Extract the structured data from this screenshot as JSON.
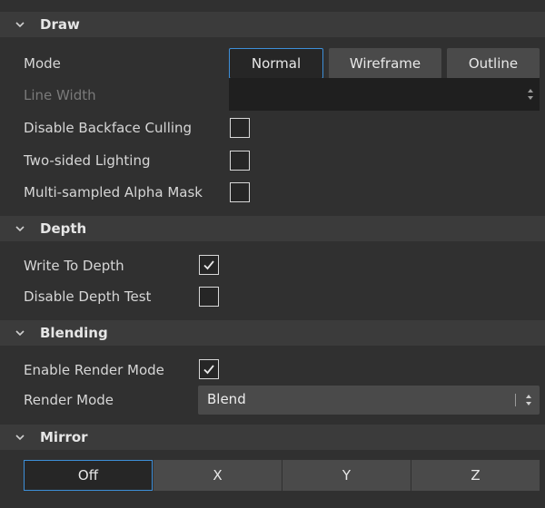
{
  "sections": {
    "draw": {
      "title": "Draw",
      "mode_label": "Mode",
      "mode_options": [
        "Normal",
        "Wireframe",
        "Outline"
      ],
      "mode_selected": "Normal",
      "line_width_label": "Line Width",
      "line_width_value": "",
      "disable_backface_label": "Disable Backface Culling",
      "disable_backface_checked": false,
      "two_sided_label": "Two-sided Lighting",
      "two_sided_checked": false,
      "alpha_mask_label": "Multi-sampled Alpha Mask",
      "alpha_mask_checked": false
    },
    "depth": {
      "title": "Depth",
      "write_label": "Write To Depth",
      "write_checked": true,
      "disable_test_label": "Disable Depth Test",
      "disable_test_checked": false
    },
    "blending": {
      "title": "Blending",
      "enable_label": "Enable Render Mode",
      "enable_checked": true,
      "render_mode_label": "Render Mode",
      "render_mode_value": "Blend"
    },
    "mirror": {
      "title": "Mirror",
      "options": [
        "Off",
        "X",
        "Y",
        "Z"
      ],
      "selected": "Off"
    }
  },
  "colors": {
    "background": "#303030",
    "header": "#3b3b3b",
    "accent": "#3d8fd9",
    "button": "#4a4a4a",
    "field": "#1f1f1f"
  },
  "icons": [
    "chevron-down-icon",
    "checkmark-icon",
    "spinner-arrows-icon",
    "select-arrows-icon"
  ]
}
